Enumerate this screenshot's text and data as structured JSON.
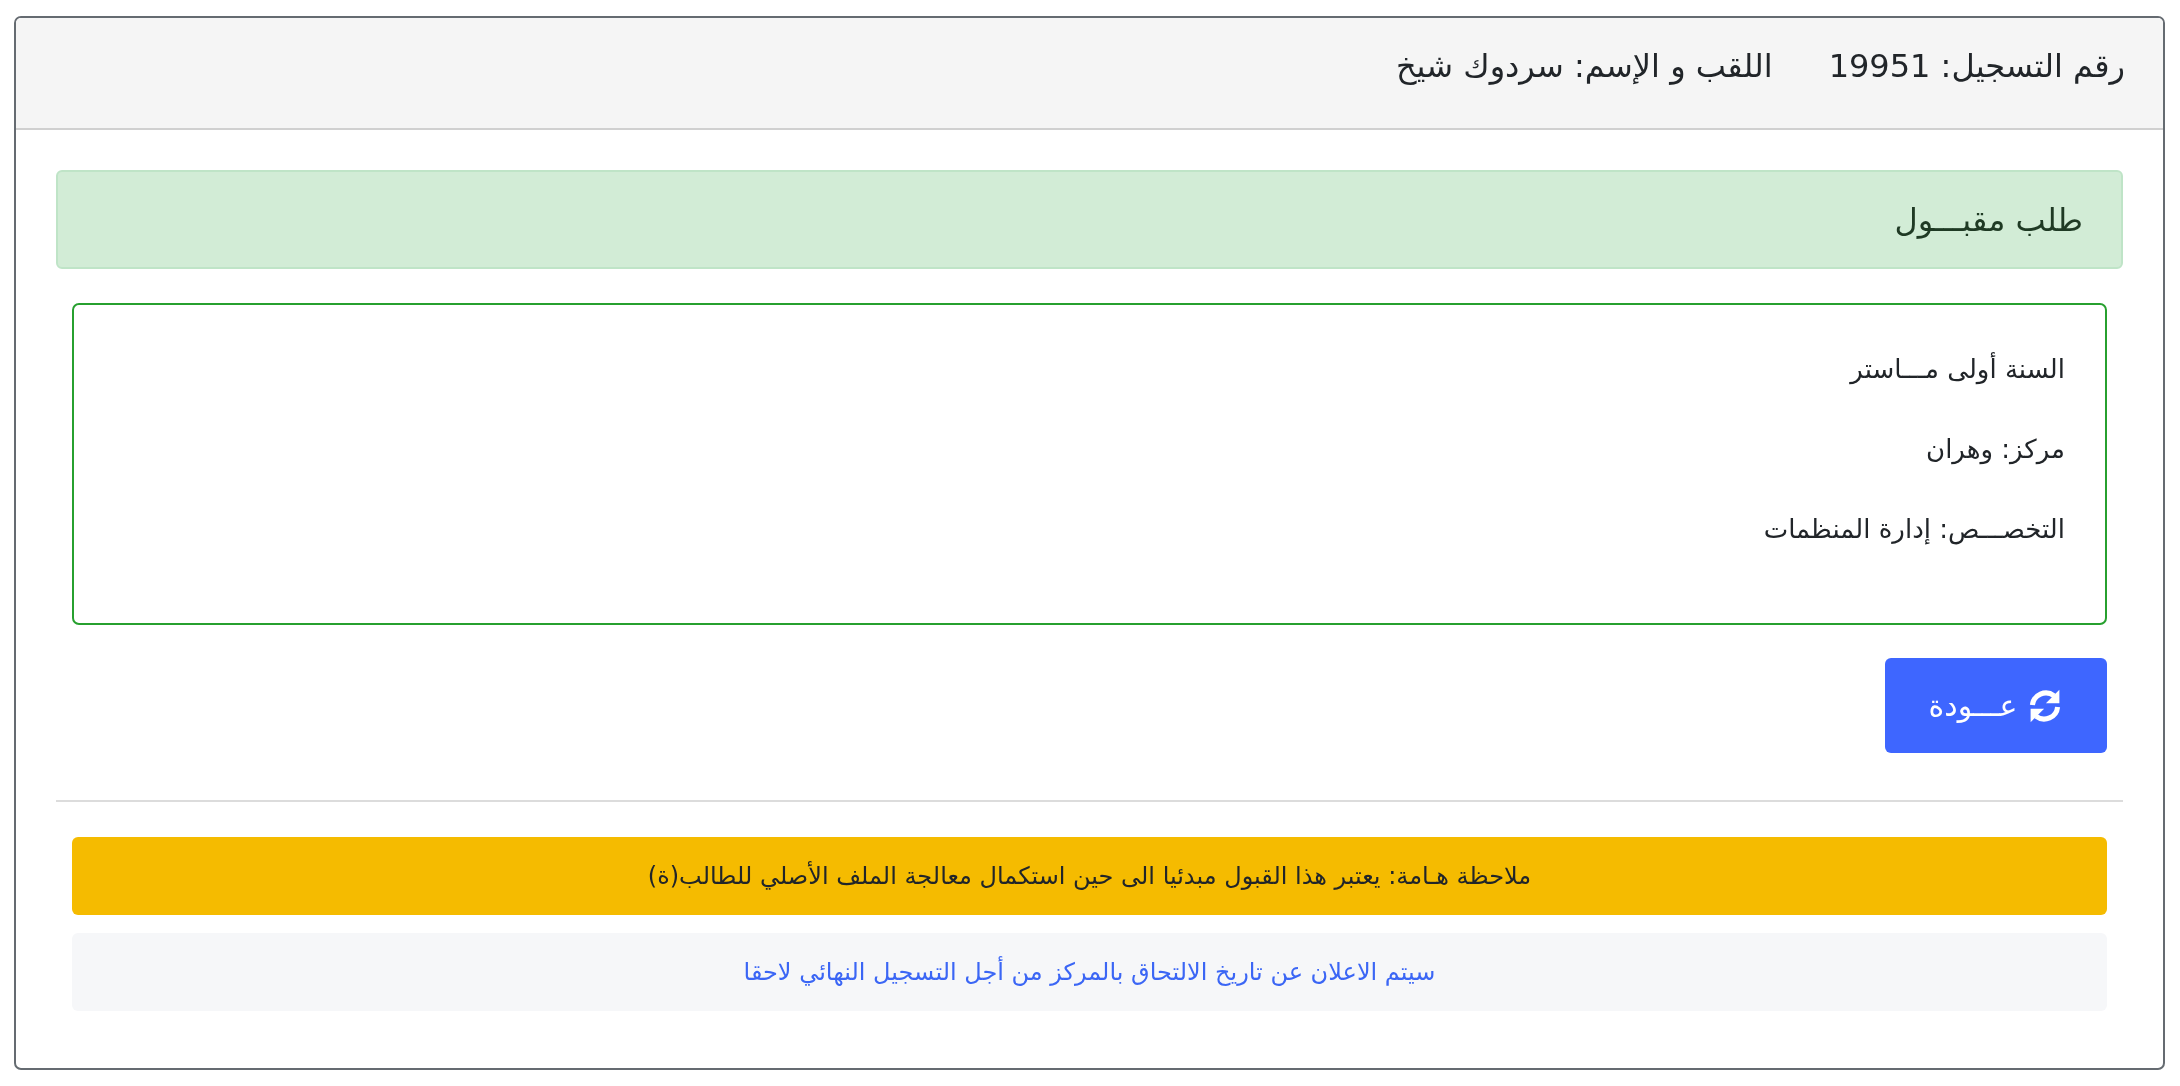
{
  "header": {
    "items": [
      "رقم التسجيل: 19951",
      "اللقب و الإسم: سردوك شيخ"
    ]
  },
  "status_alert": {
    "kind": "success",
    "text": "طلب مقبـــول"
  },
  "details": {
    "lines": [
      "السنة أولى مـــاستر",
      "مركز: وهران",
      "التخصـــص: إدارة المنظمات"
    ]
  },
  "back_button": {
    "label": "عـــودة"
  },
  "notices": [
    {
      "kind": "warning",
      "text": "ملاحظة هـامة: يعتبر هذا القبول مبدئيا الى حين استكمال معالجة الملف الأصلي للطالب(ة)"
    },
    {
      "kind": "info",
      "text": "سيتم الاعلان عن تاريخ الالتحاق بالمركز من أجل التسجيل النهائي لاحقا"
    }
  ]
}
